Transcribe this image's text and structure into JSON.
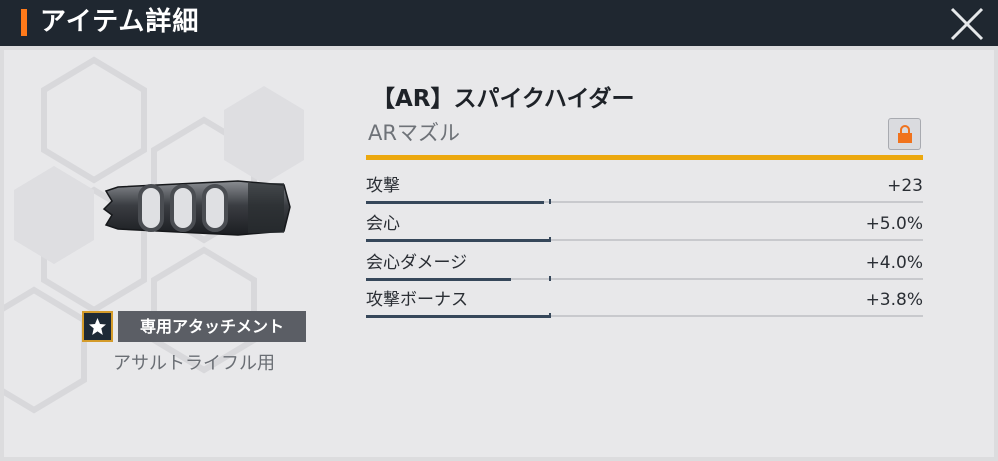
{
  "header": {
    "title": "アイテム詳細"
  },
  "item": {
    "name": "【AR】スパイクハイダー",
    "type": "ARマズル",
    "rarity_color": "#eca80e",
    "tag_label": "専用アタッチメント",
    "usage": "アサルトライフル用"
  },
  "stats": [
    {
      "label": "攻撃",
      "value": "+23",
      "fill": 0.32
    },
    {
      "label": "会心",
      "value": "+5.0%",
      "fill": 0.33
    },
    {
      "label": "会心ダメージ",
      "value": "+4.0%",
      "fill": 0.26
    },
    {
      "label": "攻撃ボーナス",
      "value": "+3.8%",
      "fill": 0.33
    }
  ],
  "icons": {
    "close": "close-icon",
    "lock": "lock-icon",
    "tag": "star-badge-icon"
  },
  "colors": {
    "accent": "#ff7a1a",
    "header_bg": "#1f2730",
    "lock": "#f0731e"
  }
}
